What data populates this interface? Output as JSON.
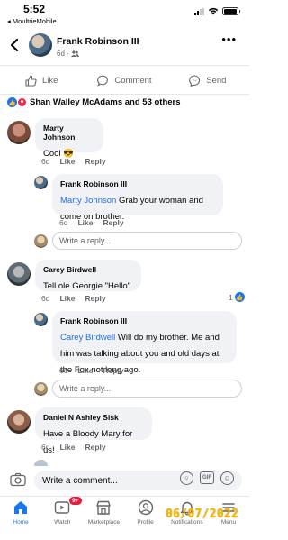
{
  "status": {
    "time": "5:52",
    "back_app": "◂ MoultrieMobile"
  },
  "post": {
    "author": "Frank Robinson III",
    "age": "6d"
  },
  "actions": {
    "like": "Like",
    "comment": "Comment",
    "send": "Send"
  },
  "reactions": {
    "summary": "Shan Walley McAdams and 53 others"
  },
  "comments": [
    {
      "author": "Marty Johnson",
      "text": "Cool 😎",
      "age": "6d",
      "like": "Like",
      "reply": "Reply"
    },
    {
      "author": "Frank Robinson III",
      "mention": "Marty Johnson",
      "text": " Grab your woman and come on brother.",
      "age": "6d",
      "like": "Like",
      "reply": "Reply"
    },
    {
      "author": "Carey Birdwell",
      "text": "Tell ole Georgie \"Hello\"",
      "age": "6d",
      "like": "Like",
      "reply": "Reply",
      "like_count": "1"
    },
    {
      "author": "Frank Robinson III",
      "mention": "Carey Birdwell",
      "text": " Will do my brother. Me and him was talking about you and old days at the Fox not long ago.",
      "age": "6d",
      "like": "Like",
      "reply": "Reply"
    },
    {
      "author": "Daniel N Ashley Sisk",
      "text": "Have a Bloody Mary for us!",
      "age": "6d",
      "like": "Like",
      "reply": "Reply"
    }
  ],
  "reply_placeholder": "Write a reply...",
  "composer": {
    "placeholder": "Write a comment...",
    "gif": "GIF"
  },
  "tabs": [
    {
      "label": "Home",
      "icon": "home-icon"
    },
    {
      "label": "Watch",
      "icon": "watch-icon",
      "badge": "9+"
    },
    {
      "label": "Marketplace",
      "icon": "marketplace-icon"
    },
    {
      "label": "Profile",
      "icon": "profile-icon"
    },
    {
      "label": "Notifications",
      "icon": "bell-icon"
    },
    {
      "label": "Menu",
      "icon": "menu-icon"
    }
  ],
  "overlay": {
    "date_stamp": "06/07/2022"
  },
  "colors": {
    "brand": "#1877f2",
    "mention": "#216fdb",
    "bubble": "#f0f2f5",
    "badge": "#e41e3f",
    "date_stamp": "#f5b700"
  }
}
